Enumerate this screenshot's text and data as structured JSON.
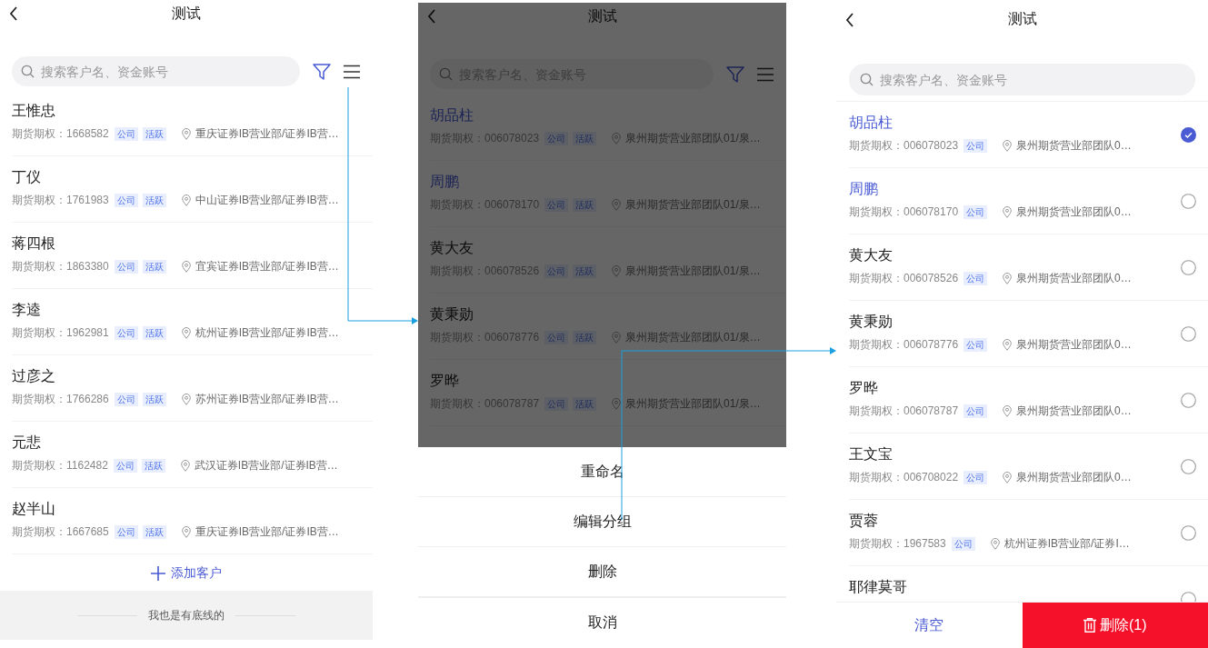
{
  "screens": [
    {
      "kind": "list",
      "title": "测试",
      "search": {
        "placeholder": "搜索客户名、资金账号"
      },
      "toolbar": true,
      "rows": [
        {
          "name": "王惟忠",
          "meta": "期货期权：1668582",
          "tags": [
            "公司",
            "活跃"
          ],
          "branch": "重庆证券IB营业部/证券IB营…",
          "highlighted": false
        },
        {
          "name": "丁仪",
          "meta": "期货期权：1761983",
          "tags": [
            "公司",
            "活跃"
          ],
          "branch": "中山证券IB营业部/证券IB营…",
          "highlighted": false
        },
        {
          "name": "蒋四根",
          "meta": "期货期权：1863380",
          "tags": [
            "公司",
            "活跃"
          ],
          "branch": "宜宾证券IB营业部/证券IB营…",
          "highlighted": false
        },
        {
          "name": "李逵",
          "meta": "期货期权：1962981",
          "tags": [
            "公司",
            "活跃"
          ],
          "branch": "杭州证券IB营业部/证券IB营…",
          "highlighted": false
        },
        {
          "name": "过彦之",
          "meta": "期货期权：1766286",
          "tags": [
            "公司",
            "活跃"
          ],
          "branch": "苏州证券IB营业部/证券IB营…",
          "highlighted": false
        },
        {
          "name": "元悲",
          "meta": "期货期权：1162482",
          "tags": [
            "公司",
            "活跃"
          ],
          "branch": "武汉证券IB营业部/证券IB营…",
          "highlighted": false
        },
        {
          "name": "赵半山",
          "meta": "期货期权：1667685",
          "tags": [
            "公司",
            "活跃"
          ],
          "branch": "重庆证券IB营业部/证券IB营…",
          "highlighted": false
        }
      ],
      "add_button": "添加客户",
      "footer_note": "我也是有底线的"
    },
    {
      "kind": "sheet",
      "title": "测试",
      "search": {
        "placeholder": "搜索客户名、资金账号"
      },
      "toolbar": true,
      "rows": [
        {
          "name": "胡品柱",
          "meta": "期货期权：006078023",
          "tags": [
            "公司",
            "活跃"
          ],
          "branch": "泉州期货营业部团队01/泉…",
          "highlighted": true
        },
        {
          "name": "周鹏",
          "meta": "期货期权：006078170",
          "tags": [
            "公司",
            "活跃"
          ],
          "branch": "泉州期货营业部团队01/泉…",
          "highlighted": true
        },
        {
          "name": "黄大友",
          "meta": "期货期权：006078526",
          "tags": [
            "公司",
            "活跃"
          ],
          "branch": "泉州期货营业部团队01/泉…",
          "highlighted": false
        },
        {
          "name": "黄秉勋",
          "meta": "期货期权：006078776",
          "tags": [
            "公司",
            "活跃"
          ],
          "branch": "泉州期货营业部团队01/泉…",
          "highlighted": false
        },
        {
          "name": "罗晔",
          "meta": "期货期权：006078787",
          "tags": [
            "公司",
            "活跃"
          ],
          "branch": "泉州期货营业部团队01/泉…",
          "highlighted": false
        }
      ],
      "sheet": [
        "重命名",
        "编辑分组",
        "删除",
        "取消"
      ]
    },
    {
      "kind": "select",
      "title": "测试",
      "search": {
        "placeholder": "搜索客户名、资金账号"
      },
      "toolbar": false,
      "rows": [
        {
          "name": "胡品柱",
          "meta": "期货期权：006078023",
          "tags": [
            "公司"
          ],
          "branch": "泉州期货营业部团队0…",
          "highlighted": true,
          "selected": true
        },
        {
          "name": "周鹏",
          "meta": "期货期权：006078170",
          "tags": [
            "公司"
          ],
          "branch": "泉州期货营业部团队0…",
          "highlighted": true,
          "selected": false
        },
        {
          "name": "黄大友",
          "meta": "期货期权：006078526",
          "tags": [
            "公司"
          ],
          "branch": "泉州期货营业部团队0…",
          "highlighted": false,
          "selected": false
        },
        {
          "name": "黄秉勋",
          "meta": "期货期权：006078776",
          "tags": [
            "公司"
          ],
          "branch": "泉州期货营业部团队0…",
          "highlighted": false,
          "selected": false
        },
        {
          "name": "罗晔",
          "meta": "期货期权：006078787",
          "tags": [
            "公司"
          ],
          "branch": "泉州期货营业部团队0…",
          "highlighted": false,
          "selected": false
        },
        {
          "name": "王文宝",
          "meta": "期货期权：006708022",
          "tags": [
            "公司"
          ],
          "branch": "泉州期货营业部团队0…",
          "highlighted": false,
          "selected": false
        },
        {
          "name": "贾蓉",
          "meta": "期货期权：1967583",
          "tags": [
            "公司"
          ],
          "branch": "杭州证券IB营业部/证券I…",
          "highlighted": false,
          "selected": false
        },
        {
          "name": "耶律莫哥",
          "highlighted": false,
          "selected": false
        }
      ],
      "actions": {
        "clear": "清空",
        "delete": "删除(1)"
      }
    }
  ]
}
